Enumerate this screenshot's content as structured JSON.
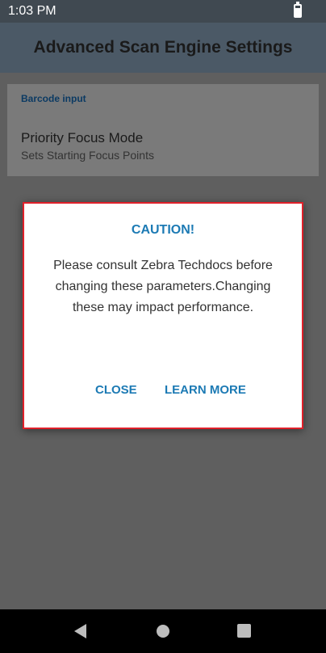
{
  "status_bar": {
    "time": "1:03 PM",
    "battery_icon": "battery-charging-icon"
  },
  "app_bar": {
    "title": "Advanced Scan Engine Settings"
  },
  "preferences": {
    "category": "Barcode input",
    "item": {
      "title": "Priority Focus Mode",
      "summary": "Sets Starting Focus Points"
    }
  },
  "dialog": {
    "title": "CAUTION!",
    "message": "Please consult Zebra Techdocs before changing these parameters.Changing these may impact performance.",
    "close_label": "CLOSE",
    "learn_more_label": "LEARN MORE",
    "border_color": "#e0202a",
    "accent_color": "#1c7ab4"
  },
  "nav_bar": {
    "back_icon": "back-triangle-icon",
    "home_icon": "home-circle-icon",
    "recents_icon": "recents-square-icon"
  }
}
